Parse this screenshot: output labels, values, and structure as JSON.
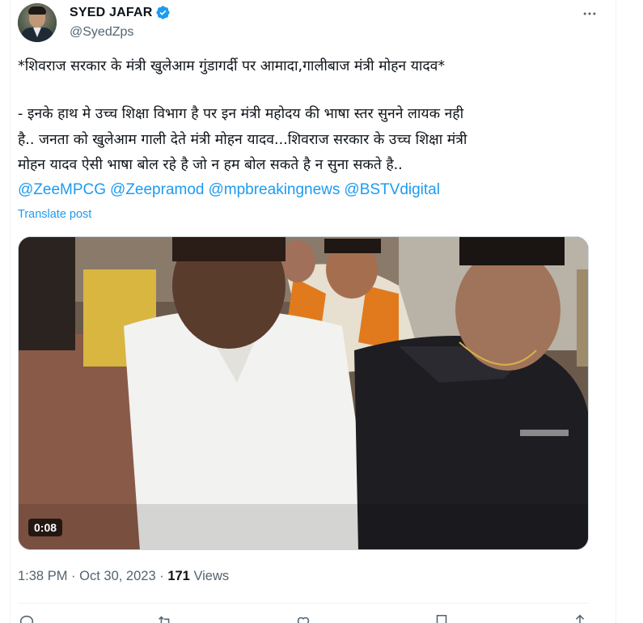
{
  "author": {
    "display_name": "SYED JAFAR",
    "handle": "@SyedZps",
    "verified": true
  },
  "icons": {
    "avatar": "profile-photo",
    "verified": "verified-badge-icon",
    "more": "more-options-icon",
    "actions": [
      "reply-icon",
      "retweet-icon",
      "like-icon",
      "bookmark-icon",
      "share-icon"
    ]
  },
  "tweet": {
    "lines": [
      "*शिवराज सरकार के मंत्री खुलेआम गुंडागर्दी पर आमादा,गालीबाज मंत्री मोहन यादव*",
      "- इनके हाथ मे उच्च शिक्षा विभाग है पर इन मंत्री महोदय की भाषा स्तर सुनने लायक  नही",
      "है.. जनता को खुलेआम गाली देते मंत्री मोहन यादव...शिवराज सरकार के उच्च शिक्षा मंत्री",
      "मोहन यादव ऐसी भाषा बोल रहे है जो न हम बोल सकते है न सुना सकते है.."
    ],
    "mentions": [
      "@ZeeMPCG",
      "@Zeepramod",
      "@mpbreakingnews",
      "@BSTVdigital"
    ],
    "translate_label": "Translate post"
  },
  "media": {
    "type": "video",
    "duration": "0:08"
  },
  "meta": {
    "time": "1:38 PM",
    "separator": "·",
    "date": "Oct 30, 2023",
    "views_count": "171",
    "views_label": "Views"
  },
  "colors": {
    "accent": "#1d9bf0",
    "secondary_text": "#536471",
    "primary_text": "#0f1419",
    "border": "#eff3f4"
  }
}
